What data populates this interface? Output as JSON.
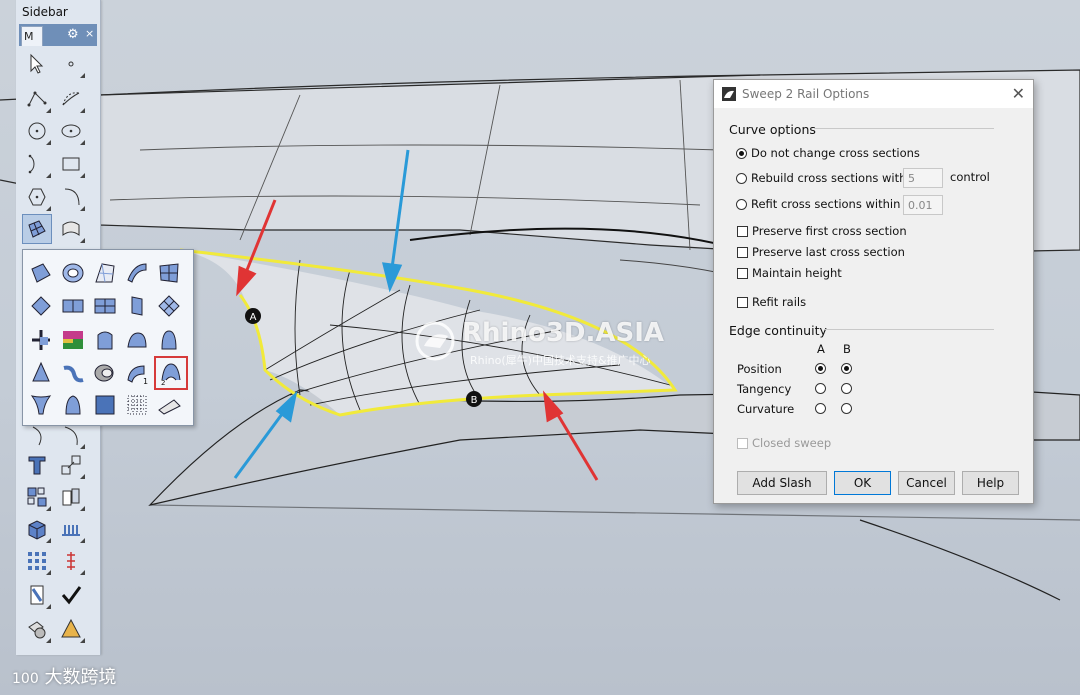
{
  "sidebar": {
    "title": "Sidebar",
    "tab_label": "M",
    "gear_icon": "gear-icon",
    "close_glyph": "×"
  },
  "flyout": {
    "highlighted_tool": "sweep-2-rails-tool",
    "highlight_color": "#d63a3a"
  },
  "viewport": {
    "point_a_label": "A",
    "point_b_label": "B",
    "arrow_colors": {
      "red": "#e03434",
      "blue": "#2a9ad8"
    },
    "edge_highlight_color": "#f1ea3a"
  },
  "watermark": {
    "brand": "Rhino3D.ASIA",
    "subtitle": "Rhino(犀牛)中国技术支持&推广中心"
  },
  "bottom_logo": {
    "text": "大数跨境",
    "prefix": "100"
  },
  "dialog": {
    "title": "Sweep 2 Rail Options",
    "curve_options": {
      "heading": "Curve options",
      "do_not_change": "Do not change cross sections",
      "rebuild": "Rebuild cross sections with",
      "rebuild_value": "5",
      "rebuild_unit": "control",
      "refit": "Refit cross sections within",
      "refit_value": "0.01",
      "selected": "do_not_change",
      "preserve_first": "Preserve first cross section",
      "preserve_last": "Preserve last cross section",
      "maintain_height": "Maintain height",
      "refit_rails": "Refit rails"
    },
    "edge_continuity": {
      "heading": "Edge continuity",
      "col_a": "A",
      "col_b": "B",
      "rows": [
        {
          "label": "Position",
          "a": true,
          "b": true
        },
        {
          "label": "Tangency",
          "a": false,
          "b": false
        },
        {
          "label": "Curvature",
          "a": false,
          "b": false
        }
      ],
      "closed_sweep": "Closed sweep"
    },
    "buttons": {
      "add_slash": "Add Slash",
      "ok": "OK",
      "cancel": "Cancel",
      "help": "Help"
    }
  }
}
